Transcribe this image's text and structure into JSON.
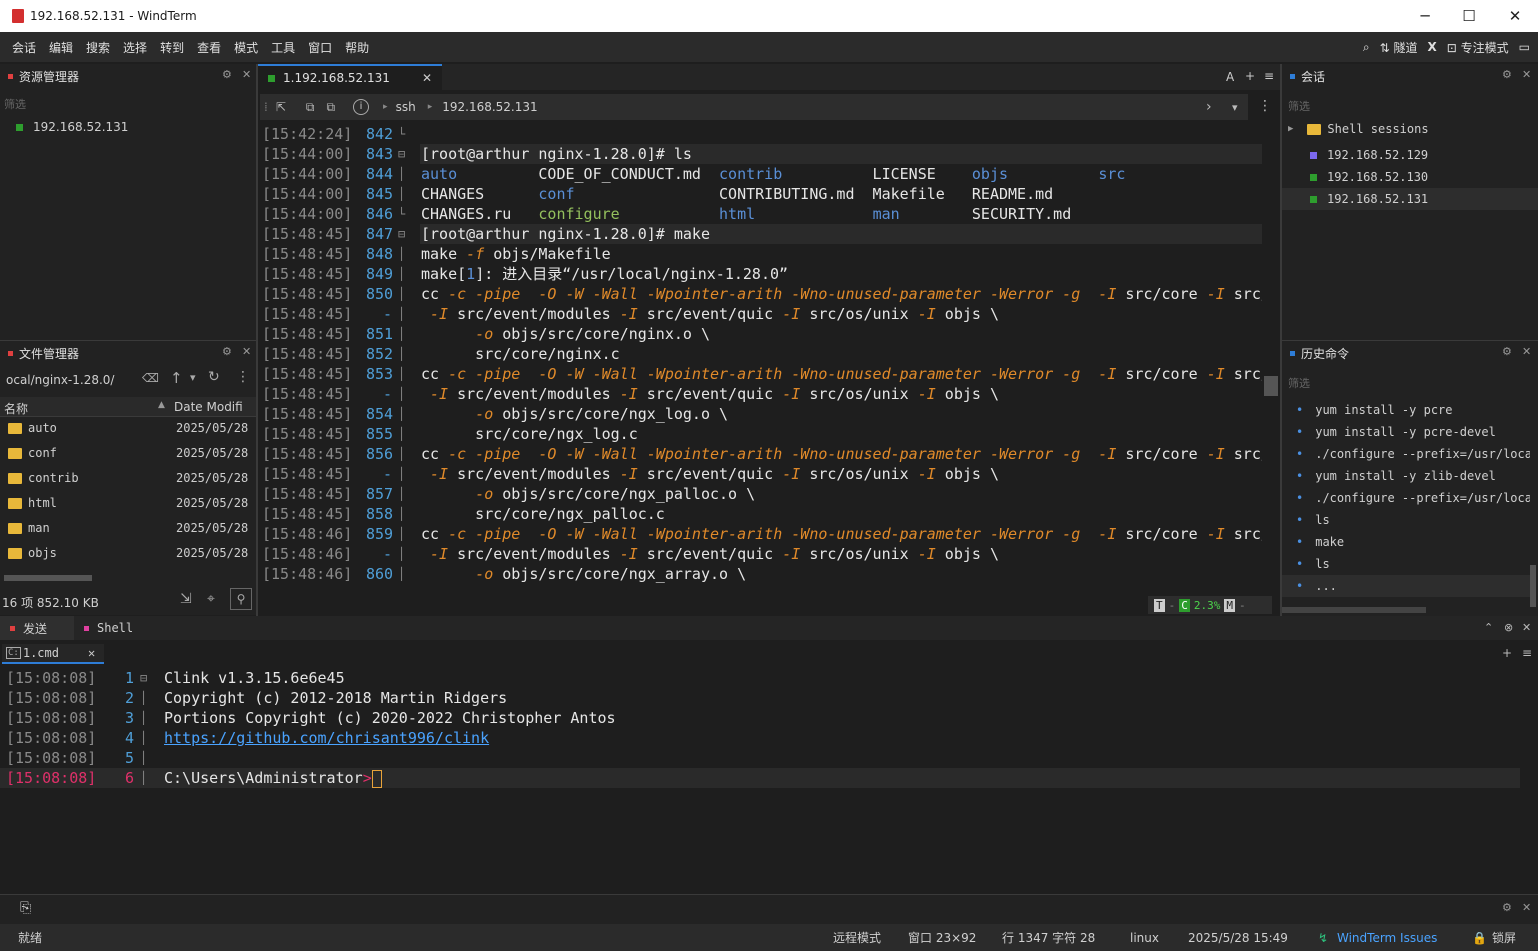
{
  "window": {
    "title": "192.168.52.131 - WindTerm",
    "min": "─",
    "max": "☐",
    "close": "✕"
  },
  "menu": [
    "会话",
    "编辑",
    "搜索",
    "选择",
    "转到",
    "查看",
    "模式",
    "工具",
    "窗口",
    "帮助"
  ],
  "menu_right": {
    "search": "⌕",
    "tunnel": "隧道",
    "x": "X",
    "focus": "专注模式"
  },
  "explorer": {
    "title": "资源管理器",
    "filter": "筛选",
    "host": "192.168.52.131"
  },
  "filemgr": {
    "title": "文件管理器",
    "path": "ocal/nginx-1.28.0/",
    "col_name": "名称",
    "col_date": "Date Modifi",
    "files": [
      {
        "name": "auto",
        "date": "2025/05/28"
      },
      {
        "name": "conf",
        "date": "2025/05/28"
      },
      {
        "name": "contrib",
        "date": "2025/05/28"
      },
      {
        "name": "html",
        "date": "2025/05/28"
      },
      {
        "name": "man",
        "date": "2025/05/28"
      },
      {
        "name": "objs",
        "date": "2025/05/28"
      }
    ],
    "summary": "16 项 852.10 KB"
  },
  "terminal": {
    "tab": "1.192.168.52.131",
    "tab_close": "✕",
    "right_ctrls": [
      "A",
      "+",
      "≡"
    ],
    "crumb_ssh": "ssh",
    "crumb_host": "192.168.52.131",
    "status_t": "T",
    "status_c": "C",
    "status_pct": "2.3%",
    "status_m": "M"
  },
  "lines": [
    {
      "ts": "[15:42:24]",
      "n": "842",
      "f": "└",
      "code": ""
    },
    {
      "ts": "[15:44:00]",
      "n": "843",
      "f": "⊟",
      "code": "[root@arthur nginx-1.28.0]# ls",
      "hl": true
    },
    {
      "ts": "[15:44:00]",
      "n": "844",
      "f": "│",
      "html": "<span class='bl'>auto</span>         CODE_OF_CONDUCT.md  <span class='bl'>contrib</span>          LICENSE    <span class='bl'>objs</span>          <span class='bl'>src</span>"
    },
    {
      "ts": "[15:44:00]",
      "n": "845",
      "f": "│",
      "html": "CHANGES      <span class='bl'>conf</span>                CONTRIBUTING.md  Makefile   README.md"
    },
    {
      "ts": "[15:44:00]",
      "n": "846",
      "f": "└",
      "html": "CHANGES.ru   <span class='gr'>configure</span>           <span class='bl'>html</span>             <span class='bl'>man</span>        SECURITY.md"
    },
    {
      "ts": "[15:48:45]",
      "n": "847",
      "f": "⊟",
      "code": "[root@arthur nginx-1.28.0]# make",
      "hl": true
    },
    {
      "ts": "[15:48:45]",
      "n": "848",
      "f": "│",
      "html": "make <span class='or it'>-f</span> objs/Makefile"
    },
    {
      "ts": "[15:48:45]",
      "n": "849",
      "f": "│",
      "html": "make[<span class='bl'>1</span>]: 进入目录“/usr/local/nginx-1.28.0”"
    },
    {
      "ts": "[15:48:45]",
      "n": "850",
      "f": "│",
      "html": "cc <span class='or it'>-c -pipe  -O -W -Wall -Wpointer-arith -Wno-unused-parameter -Werror -g  -I</span> src/core <span class='or it'>-I</span> src/event<span class='cy'>↲</span>"
    },
    {
      "ts": "[15:48:45]",
      "n": "-",
      "f": "│",
      "html": " <span class='or it'>-I</span> src/event/modules <span class='or it'>-I</span> src/event/quic <span class='or it'>-I</span> src/os/unix <span class='or it'>-I</span> objs \\"
    },
    {
      "ts": "[15:48:45]",
      "n": "851",
      "f": "│",
      "html": "      <span class='or it'>-o</span> objs/src/core/nginx.o \\"
    },
    {
      "ts": "[15:48:45]",
      "n": "852",
      "f": "│",
      "html": "      src/core/nginx.c"
    },
    {
      "ts": "[15:48:45]",
      "n": "853",
      "f": "│",
      "html": "cc <span class='or it'>-c -pipe  -O -W -Wall -Wpointer-arith -Wno-unused-parameter -Werror -g  -I</span> src/core <span class='or it'>-I</span> src/event<span class='cy'>↲</span>"
    },
    {
      "ts": "[15:48:45]",
      "n": "-",
      "f": "│",
      "html": " <span class='or it'>-I</span> src/event/modules <span class='or it'>-I</span> src/event/quic <span class='or it'>-I</span> src/os/unix <span class='or it'>-I</span> objs \\"
    },
    {
      "ts": "[15:48:45]",
      "n": "854",
      "f": "│",
      "html": "      <span class='or it'>-o</span> objs/src/core/ngx_log.o \\"
    },
    {
      "ts": "[15:48:45]",
      "n": "855",
      "f": "│",
      "html": "      src/core/ngx_log.c"
    },
    {
      "ts": "[15:48:45]",
      "n": "856",
      "f": "│",
      "html": "cc <span class='or it'>-c -pipe  -O -W -Wall -Wpointer-arith -Wno-unused-parameter -Werror -g  -I</span> src/core <span class='or it'>-I</span> src/event<span class='cy'>↲</span>"
    },
    {
      "ts": "[15:48:45]",
      "n": "-",
      "f": "│",
      "html": " <span class='or it'>-I</span> src/event/modules <span class='or it'>-I</span> src/event/quic <span class='or it'>-I</span> src/os/unix <span class='or it'>-I</span> objs \\"
    },
    {
      "ts": "[15:48:45]",
      "n": "857",
      "f": "│",
      "html": "      <span class='or it'>-o</span> objs/src/core/ngx_palloc.o \\"
    },
    {
      "ts": "[15:48:45]",
      "n": "858",
      "f": "│",
      "html": "      src/core/ngx_palloc.c"
    },
    {
      "ts": "[15:48:46]",
      "n": "859",
      "f": "│",
      "html": "cc <span class='or it'>-c -pipe  -O -W -Wall -Wpointer-arith -Wno-unused-parameter -Werror -g  -I</span> src/core <span class='or it'>-I</span> src/event<span class='cy'>↲</span>"
    },
    {
      "ts": "[15:48:46]",
      "n": "-",
      "f": "│",
      "html": " <span class='or it'>-I</span> src/event/modules <span class='or it'>-I</span> src/event/quic <span class='or it'>-I</span> src/os/unix <span class='or it'>-I</span> objs \\"
    },
    {
      "ts": "[15:48:46]",
      "n": "860",
      "f": "│",
      "html": "      <span class='or it'>-o</span> objs/src/core/ngx_array.o \\"
    }
  ],
  "sessions": {
    "title": "会话",
    "filter": "筛选",
    "group": "Shell sessions",
    "items": [
      {
        "label": "192.168.52.129",
        "color": "#7b68ee"
      },
      {
        "label": "192.168.52.130",
        "color": "#2e9e2e"
      },
      {
        "label": "192.168.52.131",
        "color": "#2e9e2e"
      }
    ]
  },
  "history": {
    "title": "历史命令",
    "filter": "筛选",
    "items": [
      "yum install -y pcre",
      "yum install -y pcre-devel",
      "./configure --prefix=/usr/local",
      "yum install -y zlib-devel",
      "./configure --prefix=/usr/local",
      "ls",
      "make",
      "ls",
      "..."
    ]
  },
  "bottom": {
    "tab_send": "发送",
    "tab_shell": "Shell",
    "cmd_tab": "1.cmd",
    "lines": [
      {
        "ts": "[15:08:08]",
        "n": "1",
        "text": "Clink v1.3.15.6e6e45"
      },
      {
        "ts": "[15:08:08]",
        "n": "2",
        "text": "Copyright (c) 2012-2018 Martin Ridgers"
      },
      {
        "ts": "[15:08:08]",
        "n": "3",
        "text": "Portions Copyright (c) 2020-2022 Christopher Antos"
      },
      {
        "ts": "[15:08:08]",
        "n": "4",
        "text": "https://github.com/chrisant996/clink"
      },
      {
        "ts": "[15:08:08]",
        "n": "5",
        "text": ""
      },
      {
        "ts": "[15:08:08]",
        "n": "6",
        "text": "C:\\Users\\Administrator>"
      }
    ]
  },
  "statusbar": {
    "ready": "就绪",
    "remote": "远程模式",
    "window": "窗口 23×92",
    "pos": "行 1347 字符 28",
    "os": "linux",
    "datetime": "2025/5/28 15:49",
    "issues": "WindTerm Issues",
    "lock": "锁屏"
  }
}
